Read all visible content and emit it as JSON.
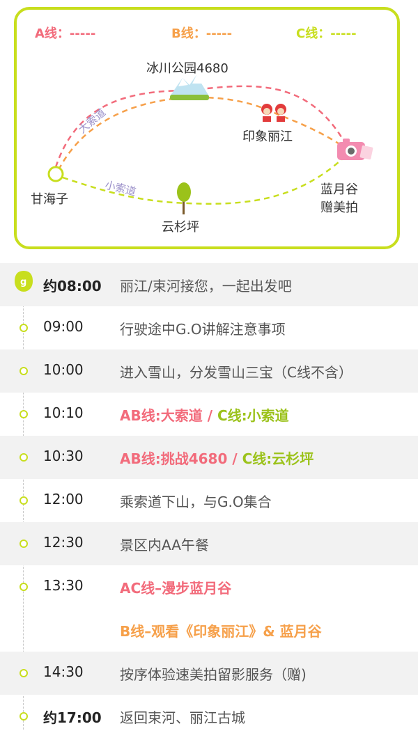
{
  "legend": {
    "a": "A线：-----",
    "b": "B线：-----",
    "c": "C线：-----"
  },
  "places": {
    "glacier": "冰川公园4680",
    "impression": "印象丽江",
    "ganhaizi": "甘海子",
    "lanyuegu_1": "蓝月谷",
    "lanyuegu_2": "赠美拍",
    "yunshanping": "云杉坪",
    "big_cableway": "大索道",
    "small_cableway": "小索道"
  },
  "timeline": [
    {
      "time": "约08:00",
      "desc": "丽江/束河接您，一起出发吧"
    },
    {
      "time": "09:00",
      "desc": "行驶途中G.O讲解注意事项"
    },
    {
      "time": "10:00",
      "desc": "进入雪山，分发雪山三宝（C线不含）"
    },
    {
      "time": "10:10",
      "ab": "AB线:大索道",
      "sep": " / ",
      "c": "C线:小索道"
    },
    {
      "time": "10:30",
      "ab": "AB线:挑战4680",
      "sep": " /  ",
      "c": "C线:云杉坪"
    },
    {
      "time": "12:00",
      "desc": "乘索道下山，与G.O集合"
    },
    {
      "time": "12:30",
      "desc": "景区内AA午餐"
    },
    {
      "time": "13:30",
      "line1": "AC线–漫步蓝月谷",
      "line2": "B线–观看《印象丽江》& 蓝月谷"
    },
    {
      "time": "14:30",
      "desc": "按序体验速美拍留影服务（赠)"
    },
    {
      "time": "约17:00",
      "desc": "返回束河、丽江古城"
    }
  ],
  "colors": {
    "a_line": "#f26b7b",
    "b_line": "#f6a04a",
    "c_line": "#c8de1e"
  }
}
